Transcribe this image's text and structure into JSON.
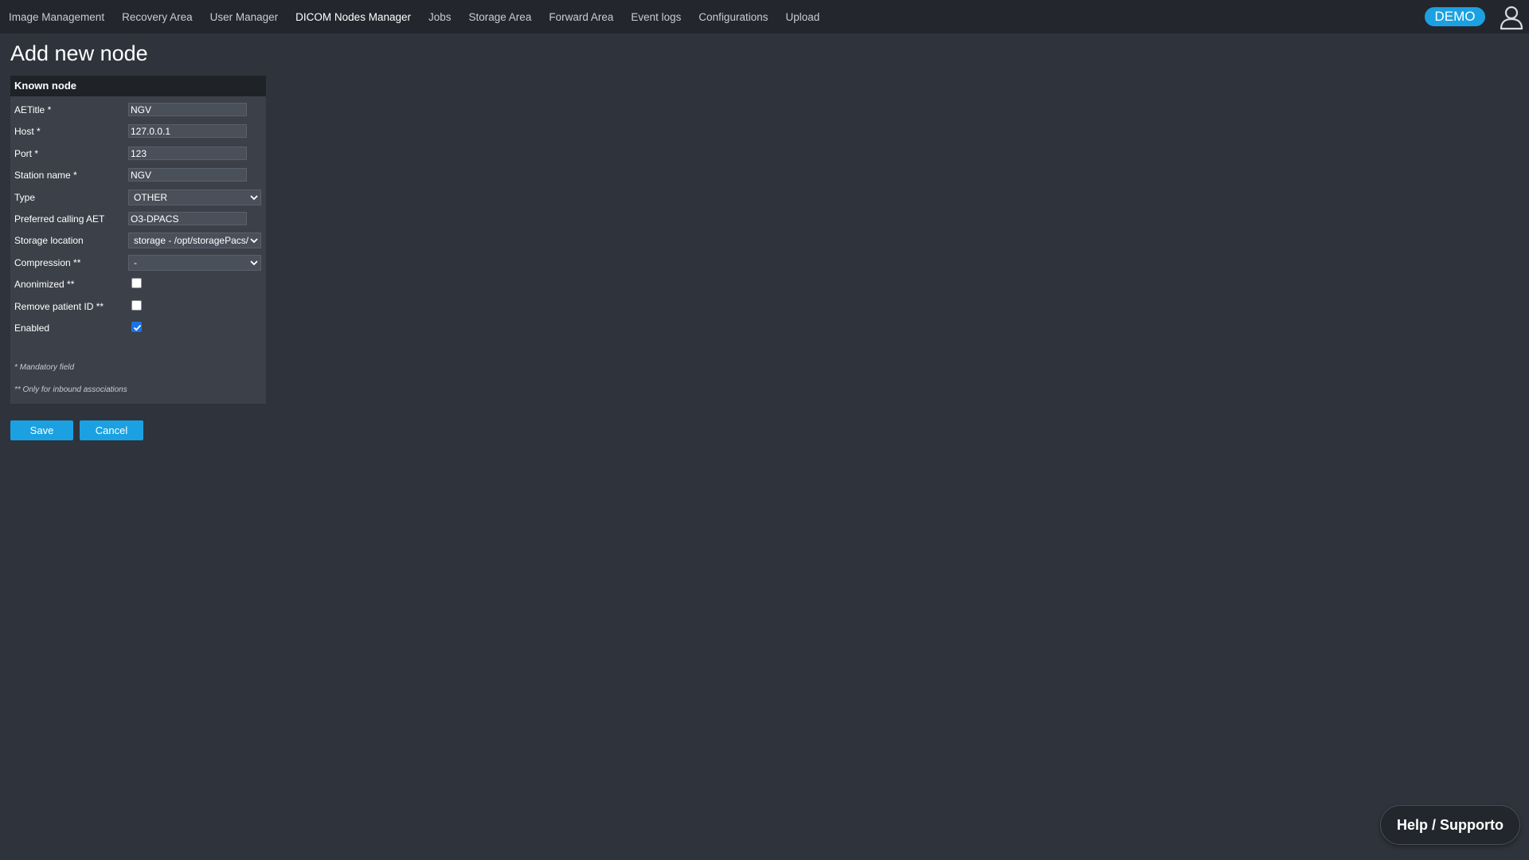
{
  "nav": {
    "items": [
      {
        "label": "Image Management",
        "active": false
      },
      {
        "label": "Recovery Area",
        "active": false
      },
      {
        "label": "User Manager",
        "active": false
      },
      {
        "label": "DICOM Nodes Manager",
        "active": true
      },
      {
        "label": "Jobs",
        "active": false
      },
      {
        "label": "Storage Area",
        "active": false
      },
      {
        "label": "Forward Area",
        "active": false
      },
      {
        "label": "Event logs",
        "active": false
      },
      {
        "label": "Configurations",
        "active": false
      },
      {
        "label": "Upload",
        "active": false
      }
    ],
    "badge": "DEMO",
    "user_icon": "user-icon"
  },
  "page": {
    "title": "Add new node"
  },
  "panel": {
    "header": "Known node",
    "fields": {
      "aetitle": {
        "label": "AETitle *",
        "value": "NGV"
      },
      "host": {
        "label": "Host *",
        "value": "127.0.0.1"
      },
      "port": {
        "label": "Port *",
        "value": "123"
      },
      "station_name": {
        "label": "Station name *",
        "value": "NGV"
      },
      "type": {
        "label": "Type",
        "value": "OTHER"
      },
      "preferred_calling_aet": {
        "label": "Preferred calling AET",
        "value": "O3-DPACS"
      },
      "storage_location": {
        "label": "Storage location",
        "value": "storage - /opt/storagePacs/"
      },
      "compression": {
        "label": "Compression **",
        "value": "-"
      },
      "anonimized": {
        "label": "Anonimized **",
        "checked": false
      },
      "remove_patient_id": {
        "label": "Remove patient ID **",
        "checked": false
      },
      "enabled": {
        "label": "Enabled",
        "checked": true
      }
    },
    "notes": {
      "mandatory": "* Mandatory field",
      "inbound": "** Only for inbound associations"
    }
  },
  "actions": {
    "save": "Save",
    "cancel": "Cancel"
  },
  "help": {
    "label": "Help / Supporto"
  },
  "colors": {
    "background": "#2f333c",
    "topbar": "#23262d",
    "accent": "#1ba1e2",
    "panel": "#3b4049",
    "panel_header": "#1f2227"
  }
}
